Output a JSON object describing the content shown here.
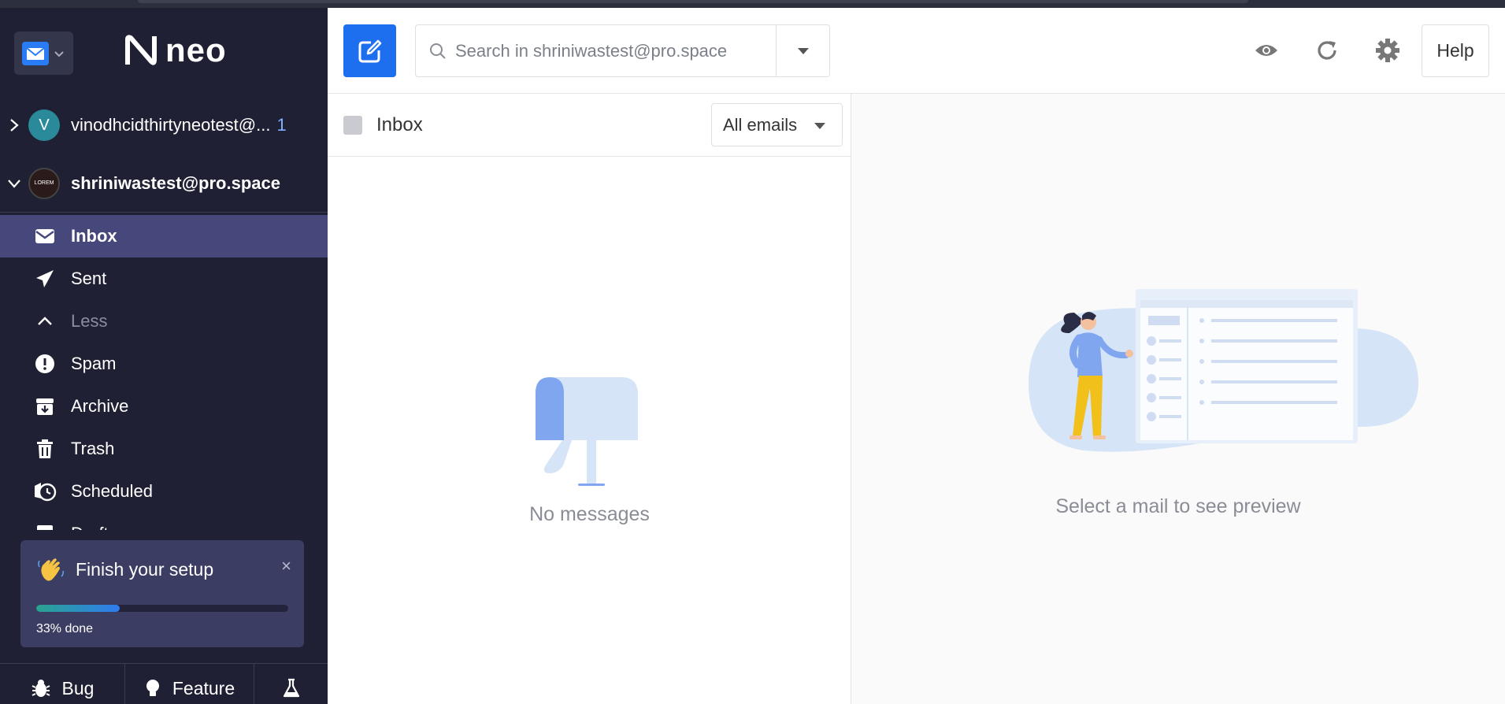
{
  "app": {
    "logo_text": "neo"
  },
  "accounts": [
    {
      "initial": "V",
      "name": "vinodhcidthirtyneotest@...",
      "unread": "1",
      "avatar_color": "#2a8a9a"
    },
    {
      "initial": "LOREM",
      "name": "shriniwastest@pro.space",
      "unread": ""
    }
  ],
  "folders": [
    {
      "label": "Inbox",
      "icon": "envelope-icon",
      "active": true
    },
    {
      "label": "Sent",
      "icon": "paper-plane-icon"
    },
    {
      "label": "Less",
      "icon": "chevron-up-icon"
    },
    {
      "label": "Spam",
      "icon": "exclamation-icon"
    },
    {
      "label": "Archive",
      "icon": "archive-icon"
    },
    {
      "label": "Trash",
      "icon": "trash-icon"
    },
    {
      "label": "Scheduled",
      "icon": "clock-icon"
    },
    {
      "label": "Drafts",
      "icon": "draft-icon"
    }
  ],
  "setup": {
    "title": "Finish your setup",
    "close": "×",
    "progress": 0.33,
    "done_label": "33% done"
  },
  "bottom": {
    "bug": "Bug",
    "feature": "Feature"
  },
  "toolbar": {
    "search_placeholder": "Search in shriniwastest@pro.space",
    "help": "Help"
  },
  "list": {
    "title": "Inbox",
    "filter": "All emails",
    "empty": "No messages"
  },
  "preview": {
    "empty": "Select a mail to see preview"
  },
  "colors": {
    "sidebar_bg": "#1f2033",
    "active_folder": "#46477a",
    "accent": "#1e6ff0"
  }
}
